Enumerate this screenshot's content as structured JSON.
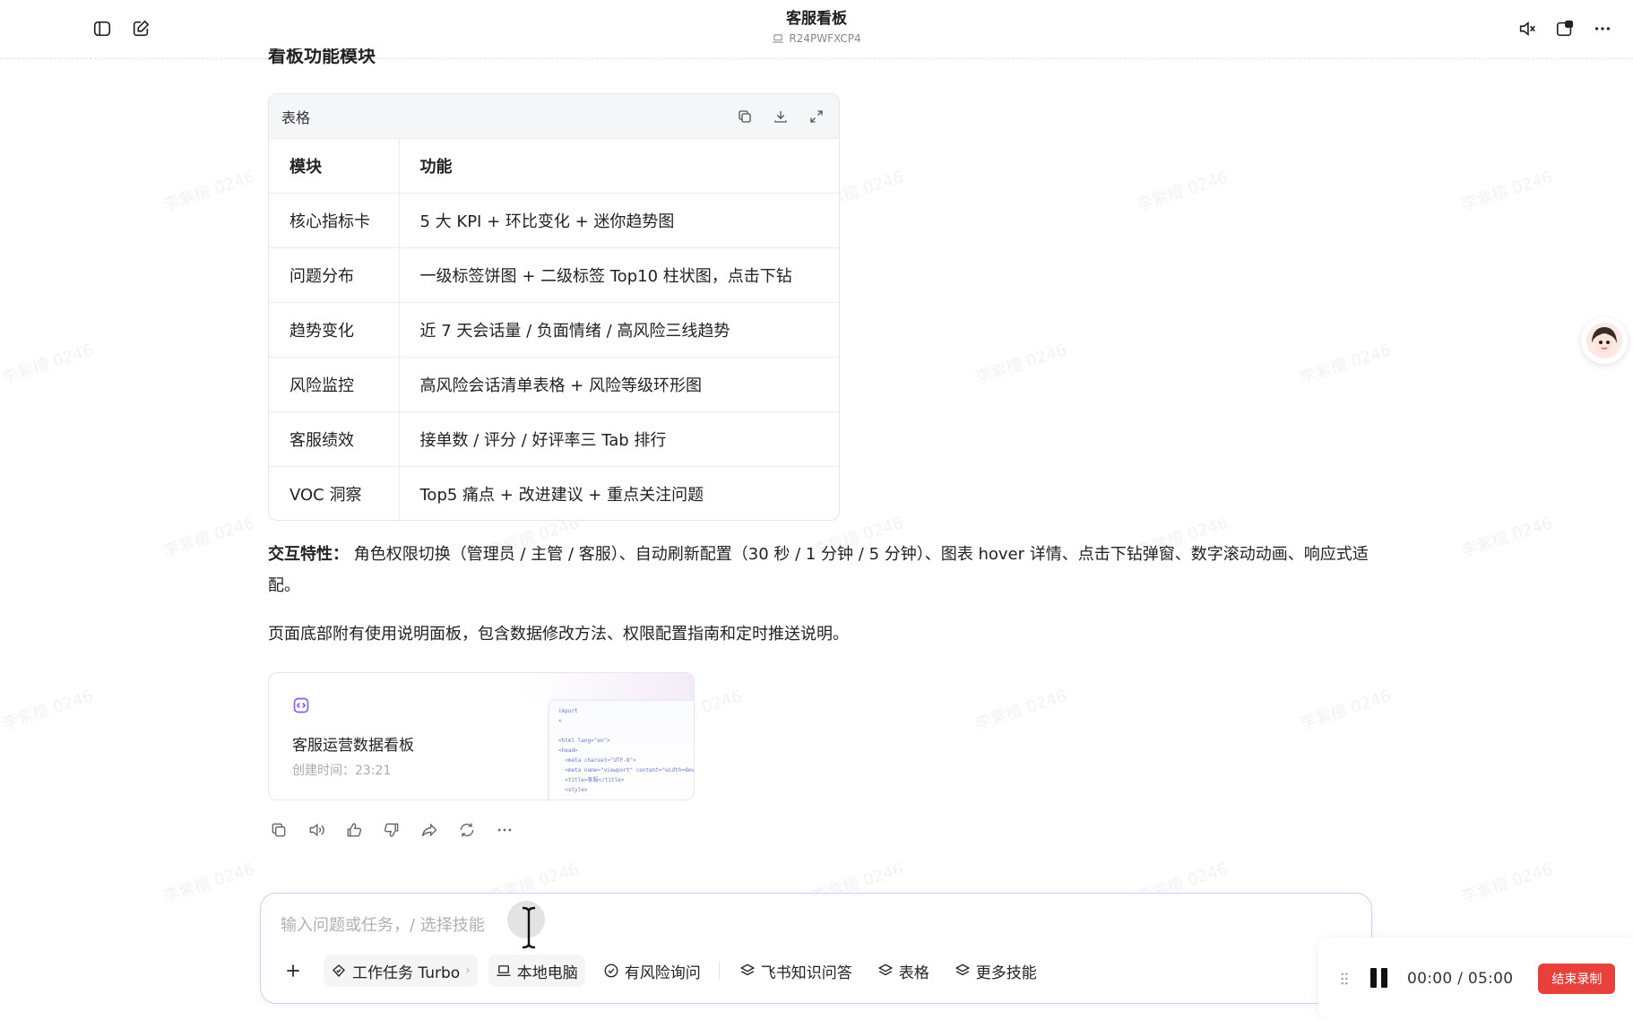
{
  "header": {
    "title": "客服看板",
    "device_id": "R24PWFXCP4"
  },
  "section_heading": "看板功能模块",
  "table_card": {
    "label": "表格",
    "columns": [
      "模块",
      "功能"
    ],
    "rows": [
      [
        "核心指标卡",
        "5 大 KPI + 环比变化 + 迷你趋势图"
      ],
      [
        "问题分布",
        "一级标签饼图 + 二级标签 Top10 柱状图，点击下钻"
      ],
      [
        "趋势变化",
        "近 7 天会话量 / 负面情绪 / 高风险三线趋势"
      ],
      [
        "风险监控",
        "高风险会话清单表格 + 风险等级环形图"
      ],
      [
        "客服绩效",
        "接单数 / 评分 / 好评率三 Tab 排行"
      ],
      [
        "VOC 洞察",
        "Top5 痛点 + 改进建议 + 重点关注问题"
      ]
    ]
  },
  "paragraphs": {
    "interaction_label": "交互特性：",
    "interaction_text": "角色权限切换（管理员 / 主管 / 客服）、自动刷新配置（30 秒 / 1 分钟 / 5 分钟）、图表 hover 详情、点击下钻弹窗、数字滚动动画、响应式适配。",
    "footer_note": "页面底部附有使用说明面板，包含数据修改方法、权限配置指南和定时推送说明。"
  },
  "file_card": {
    "name": "客服运营数据看板",
    "created_label": "创建时间：",
    "created_time": "23:21",
    "preview_code": "import\n<\n\n<html lang=\"en\">\n<head>\n  <meta charset=\"UTF-8\">\n  <meta name=\"viewport\" content=\"width=dev\n  <title>客服</title>\n  <style>"
  },
  "composer": {
    "placeholder": "输入问题或任务，/ 选择技能",
    "tools": {
      "task": "工作任务 Turbo",
      "local": "本地电脑",
      "risk": "有风险询问",
      "feishu": "飞书知识问答",
      "table": "表格",
      "more": "更多技能"
    }
  },
  "recorder": {
    "time": "00:00  /  05:00",
    "stop_label": "结束录制"
  },
  "watermark_text": "李紫檀 0246",
  "colors": {
    "accent_border": "#c7d4f5",
    "stop_red": "#e8403a",
    "file_icon_purple": "#8b5cf6"
  }
}
